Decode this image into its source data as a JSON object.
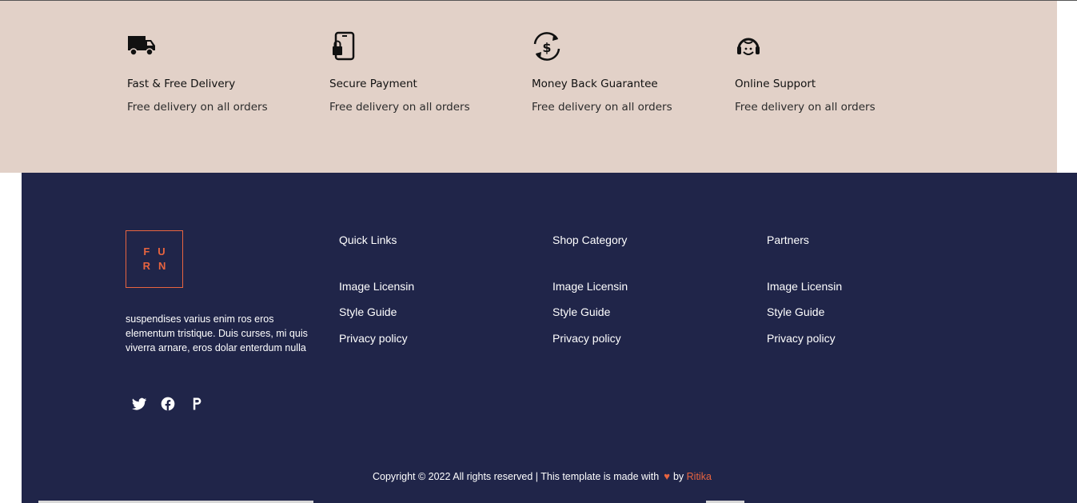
{
  "features": [
    {
      "icon": "truck-icon",
      "title": "Fast & Free Delivery",
      "desc": "Free delivery on all orders"
    },
    {
      "icon": "phone-lock-icon",
      "title": "Secure Payment",
      "desc": "Free delivery on all orders"
    },
    {
      "icon": "money-back-icon",
      "title": "Money Back Guarantee",
      "desc": "Free delivery on all orders"
    },
    {
      "icon": "headset-icon",
      "title": "Online Support",
      "desc": "Free delivery on all orders"
    }
  ],
  "footer": {
    "logo": {
      "line1": "FU",
      "line2": "RN"
    },
    "about": "suspendises varius enim ros eros elementum tristique. Duis curses, mi quis viverra arnare, eros dolar enterdum nulla",
    "social": [
      "twitter-icon",
      "facebook-icon",
      "pinterest-icon"
    ],
    "columns": [
      {
        "title": "Quick Links",
        "links": [
          "Image Licensin",
          "Style Guide",
          "Privacy policy"
        ]
      },
      {
        "title": "Shop Category",
        "links": [
          "Image Licensin",
          "Style Guide",
          "Privacy policy"
        ]
      },
      {
        "title": "Partners",
        "links": [
          "Image Licensin",
          "Style Guide",
          "Privacy policy"
        ]
      }
    ],
    "copyright": {
      "text": "Copyright © 2022 All rights reserved | This template is made with",
      "by": "by",
      "author": "Ritika"
    }
  },
  "colors": {
    "features_bg": "#e2d1c8",
    "footer_bg": "#202549",
    "accent": "#e8643f"
  }
}
